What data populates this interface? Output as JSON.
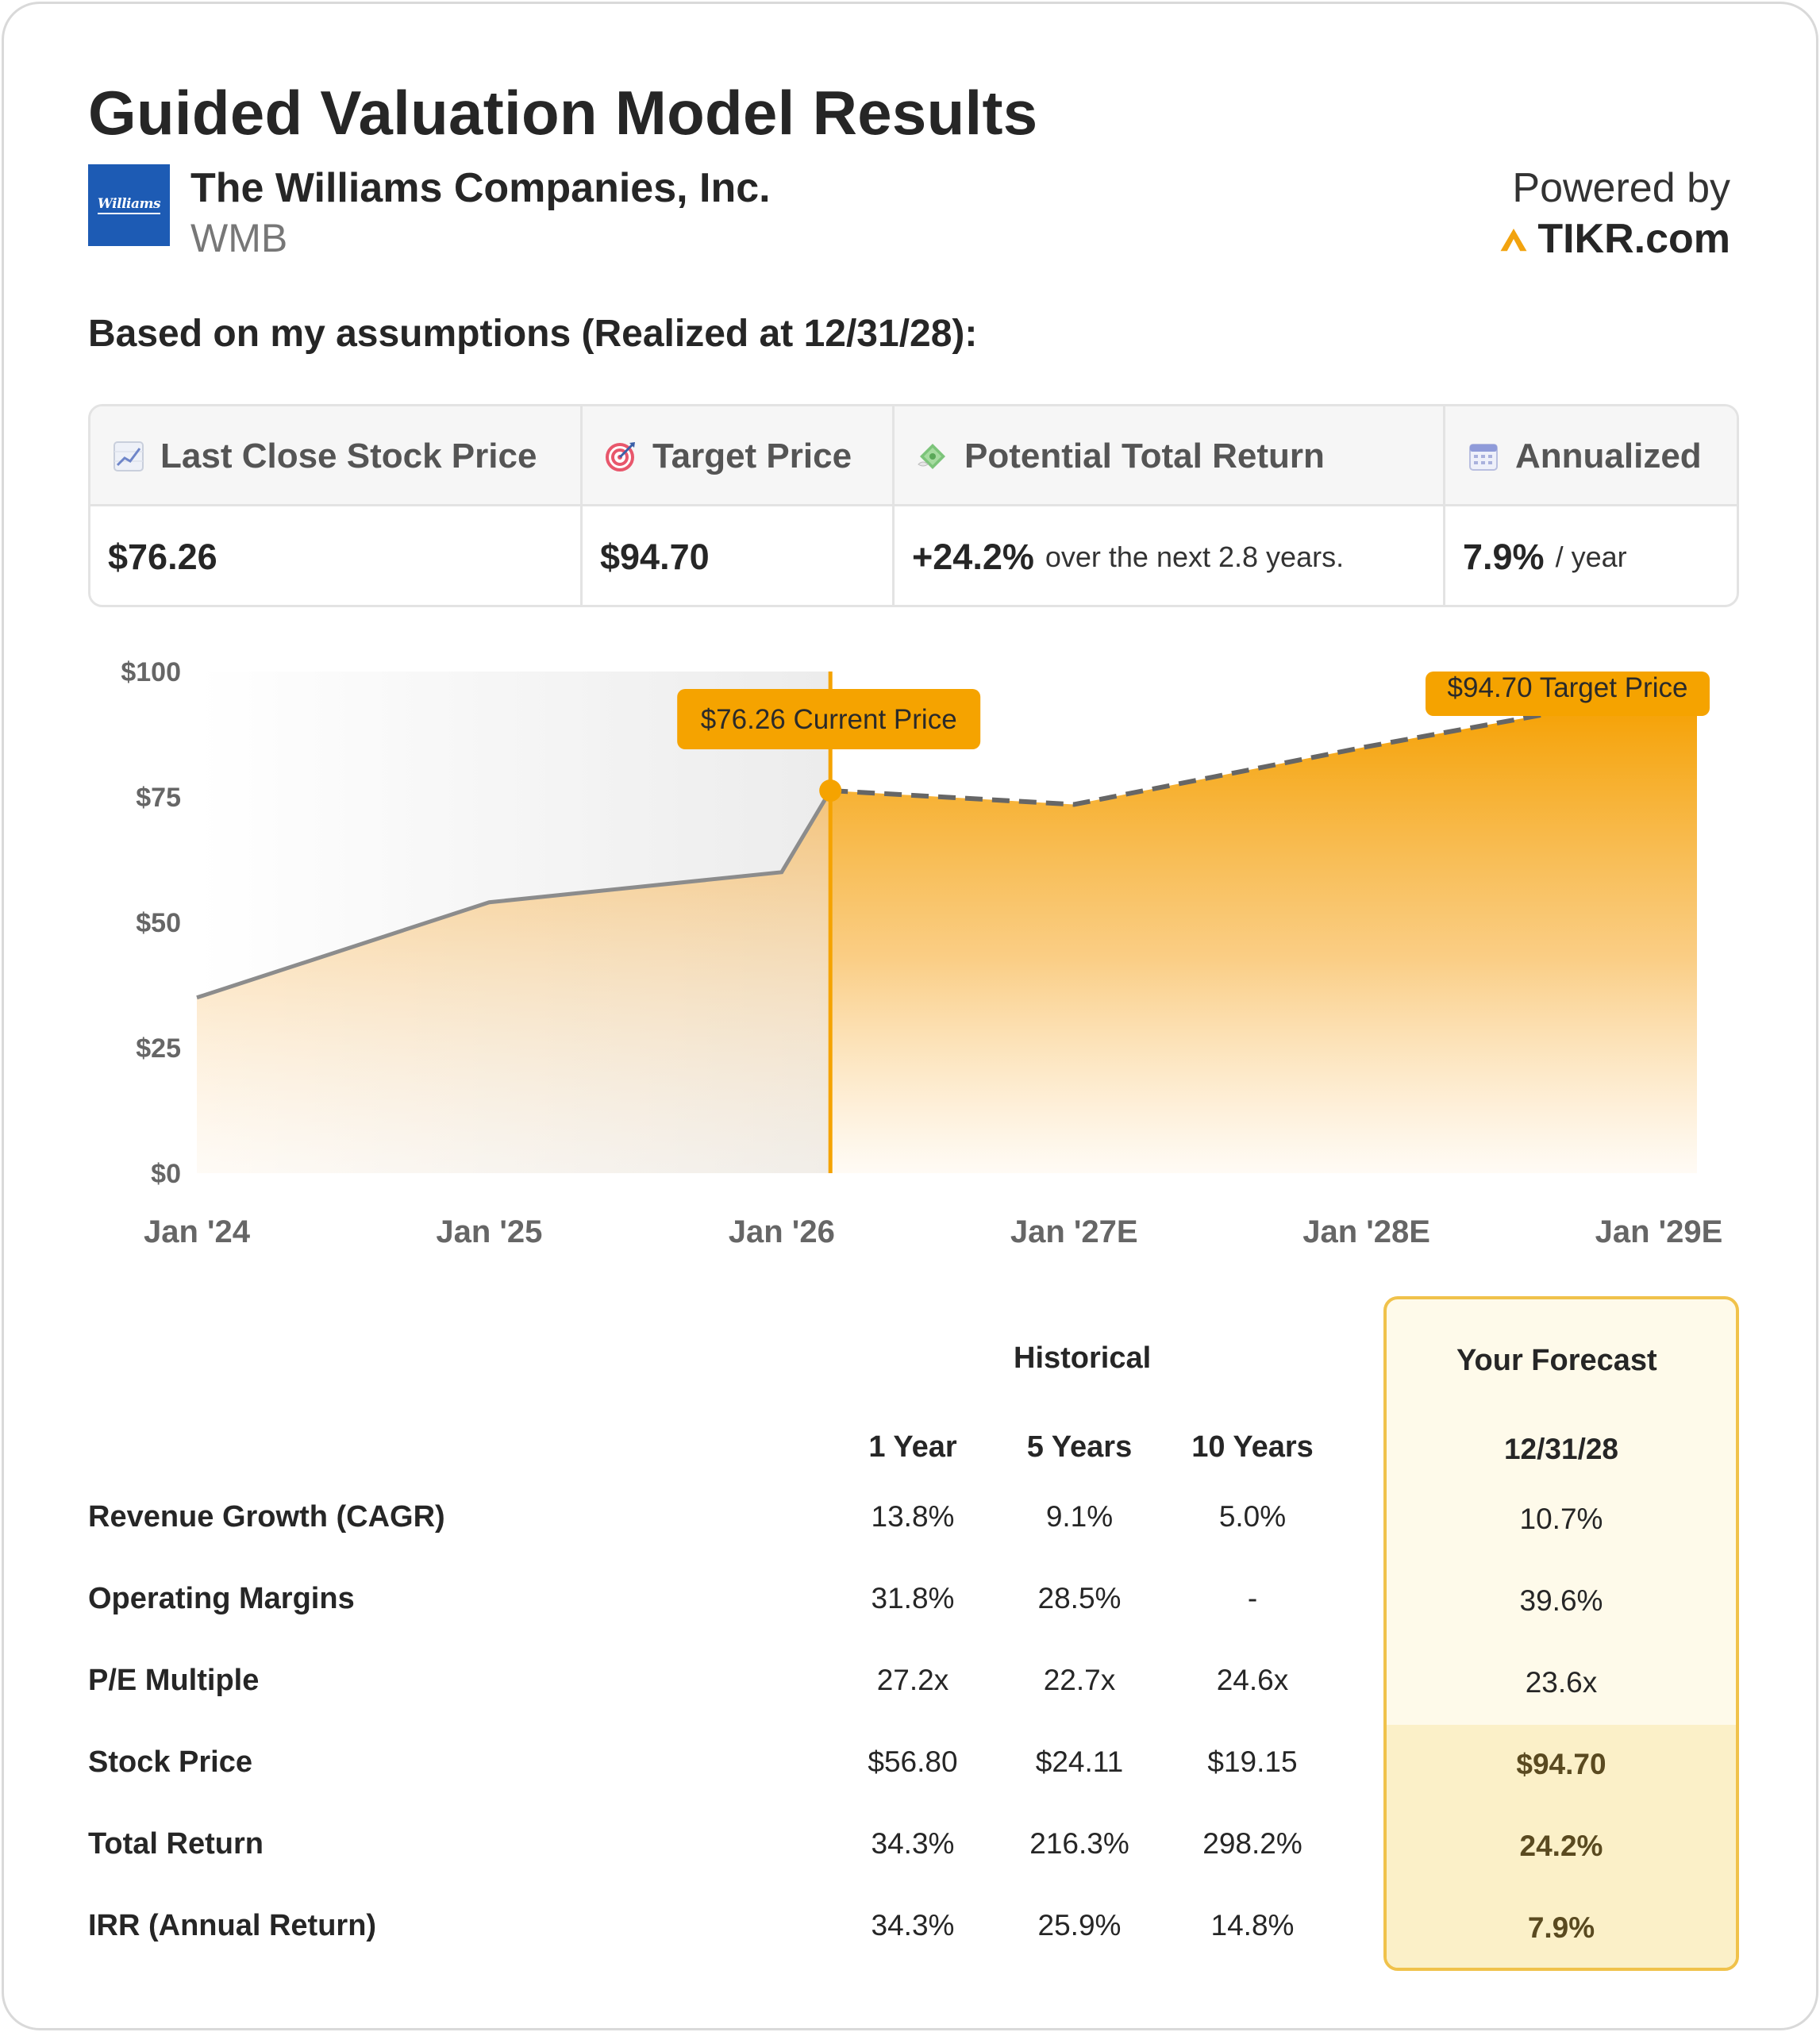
{
  "header": {
    "title": "Guided Valuation Model Results",
    "company_name": "The Williams Companies, Inc.",
    "ticker": "WMB",
    "logo_text": "Williams",
    "powered_by": "Powered by",
    "brand": "TIKR.com"
  },
  "assumptions_text": "Based on my assumptions (Realized at 12/31/28):",
  "summary": {
    "columns": [
      {
        "label": "Last Close Stock Price",
        "icon": "chart-increasing-icon",
        "value": "$76.26",
        "sub": ""
      },
      {
        "label": "Target Price",
        "icon": "target-icon",
        "value": "$94.70",
        "sub": ""
      },
      {
        "label": "Potential Total Return",
        "icon": "money-with-wings-icon",
        "value": "+24.2%",
        "sub": "over the next 2.8 years."
      },
      {
        "label": "Annualized",
        "icon": "calendar-icon",
        "value": "7.9%",
        "sub": "/ year"
      }
    ]
  },
  "chart_data": {
    "type": "area",
    "y_ticks": [
      "$100",
      "$75",
      "$50",
      "$25",
      "$0"
    ],
    "x_ticks": [
      "Jan '24",
      "Jan '25",
      "Jan '26",
      "Jan '27E",
      "Jan '28E",
      "Jan '29E"
    ],
    "ylim": [
      0,
      100
    ],
    "historical": {
      "x": [
        "2024-01",
        "2025-01",
        "2026-01",
        "2026-03"
      ],
      "y": [
        35,
        54,
        60,
        76.26
      ]
    },
    "forecast": {
      "x": [
        "2026-03",
        "2027-01",
        "2028-01",
        "2028-12"
      ],
      "y": [
        76.26,
        73.5,
        85,
        94.7
      ]
    },
    "current_label": "$76.26 Current Price",
    "target_label": "$94.70 Target Price",
    "colors": {
      "accent": "#f5a300",
      "historical_line": "#8c8c8c",
      "forecast_line": "#666666"
    }
  },
  "metrics": {
    "historical_header": "Historical",
    "forecast_header": "Your Forecast",
    "columns": [
      "1 Year",
      "5 Years",
      "10 Years"
    ],
    "forecast_date": "12/31/28",
    "rows": [
      {
        "label": "Revenue Growth (CAGR)",
        "values": [
          "13.8%",
          "9.1%",
          "5.0%"
        ],
        "forecast": "10.7%"
      },
      {
        "label": "Operating Margins",
        "values": [
          "31.8%",
          "28.5%",
          "-"
        ],
        "forecast": "39.6%"
      },
      {
        "label": "P/E Multiple",
        "values": [
          "27.2x",
          "22.7x",
          "24.6x"
        ],
        "forecast": "23.6x"
      },
      {
        "label": "Stock Price",
        "values": [
          "$56.80",
          "$24.11",
          "$19.15"
        ],
        "forecast": "$94.70"
      },
      {
        "label": "Total Return",
        "values": [
          "34.3%",
          "216.3%",
          "298.2%"
        ],
        "forecast": "24.2%"
      },
      {
        "label": "IRR (Annual Return)",
        "values": [
          "34.3%",
          "25.9%",
          "14.8%"
        ],
        "forecast": "7.9%"
      }
    ]
  }
}
